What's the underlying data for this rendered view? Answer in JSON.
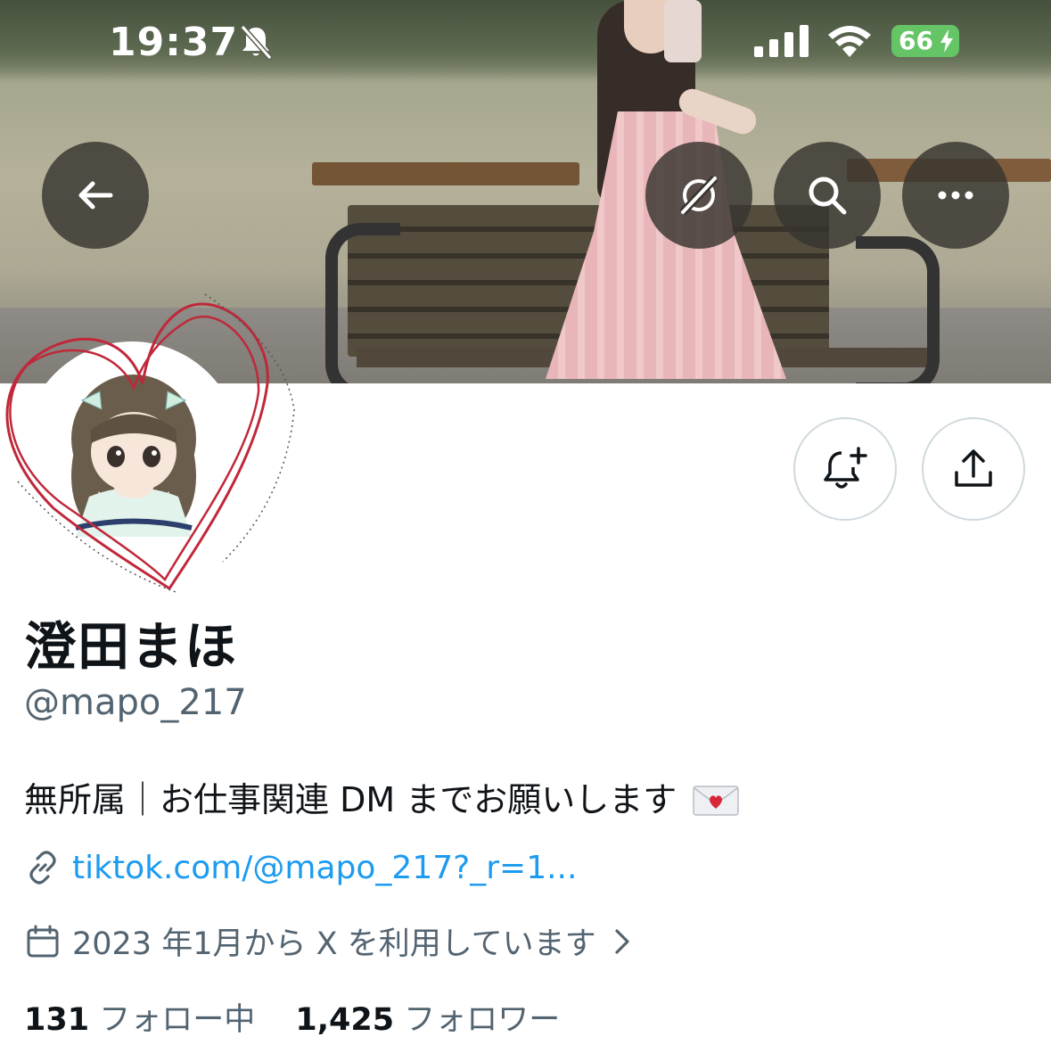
{
  "status_bar": {
    "time": "19:37",
    "battery": "66",
    "icons": [
      "bell-slash-icon",
      "signal-icon",
      "wifi-icon",
      "battery-charging-icon"
    ],
    "battery_color": "#65c466"
  },
  "header": {
    "buttons": [
      "back-arrow-icon",
      "grok-icon",
      "search-icon",
      "more-icon"
    ]
  },
  "actions": {
    "buttons": [
      "notification-add-icon",
      "share-icon"
    ]
  },
  "profile": {
    "display_name": "澄田まほ",
    "handle": "@mapo_217",
    "bio": "無所属｜お仕事関連 DM までお願いします",
    "bio_emoji": "love-letter-icon",
    "link": "tiktok.com/@mapo_217?_r=1...",
    "joined": "2023 年1月から X を利用しています",
    "following_count": "131",
    "following_label": "フォロー中",
    "followers_count": "1,425",
    "followers_label": "フォロワー"
  },
  "colors": {
    "text_primary": "#0f1419",
    "text_secondary": "#536471",
    "link": "#1d9bf0",
    "button_border": "#cfd9de"
  }
}
